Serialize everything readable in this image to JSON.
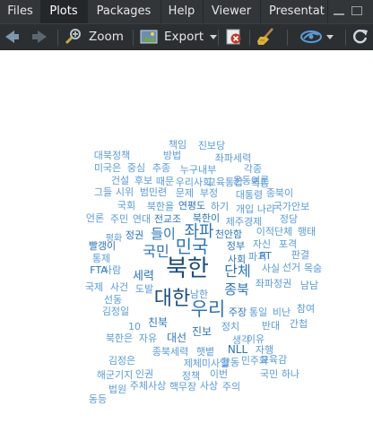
{
  "tabs": [
    {
      "label": "Files"
    },
    {
      "label": "Plots"
    },
    {
      "label": "Packages"
    },
    {
      "label": "Help"
    },
    {
      "label": "Viewer"
    },
    {
      "label": "Presentat"
    }
  ],
  "toolbar": {
    "zoom_label": "Zoom",
    "export_label": "Export"
  },
  "colors": {
    "dark_blue": "#1f4e79",
    "mid_blue": "#2e75b6",
    "light_blue": "#5b9bd5"
  },
  "wordcloud": [
    {
      "w": "북한",
      "c": "dark_blue"
    },
    {
      "w": "대한",
      "c": "dark_blue"
    },
    {
      "w": "우리",
      "c": "mid_blue"
    },
    {
      "w": "민국",
      "c": "mid_blue"
    },
    {
      "w": "좌파",
      "c": "mid_blue"
    },
    {
      "w": "국민",
      "c": "mid_blue"
    },
    {
      "w": "단체",
      "c": "mid_blue"
    },
    {
      "w": "종북",
      "c": "mid_blue"
    },
    {
      "w": "들이",
      "c": "mid_blue"
    },
    {
      "w": "세력",
      "c": "mid_blue"
    },
    {
      "w": "책임",
      "c": "light_blue"
    },
    {
      "w": "진보당",
      "c": "light_blue"
    },
    {
      "w": "대북정책",
      "c": "light_blue"
    },
    {
      "w": "방법",
      "c": "light_blue"
    },
    {
      "w": "좌파세력",
      "c": "light_blue"
    },
    {
      "w": "각종",
      "c": "light_blue"
    },
    {
      "w": "미국은",
      "c": "light_blue"
    },
    {
      "w": "중심",
      "c": "light_blue"
    },
    {
      "w": "추종",
      "c": "light_blue"
    },
    {
      "w": "누구내부",
      "c": "light_blue"
    },
    {
      "w": "운동여론",
      "c": "light_blue"
    },
    {
      "w": "건설",
      "c": "light_blue"
    },
    {
      "w": "후보",
      "c": "light_blue"
    },
    {
      "w": "때문",
      "c": "light_blue"
    },
    {
      "w": "우리사회",
      "c": "light_blue"
    },
    {
      "w": "교육통합",
      "c": "light_blue"
    },
    {
      "w": "폭동",
      "c": "light_blue"
    },
    {
      "w": "그들",
      "c": "light_blue"
    },
    {
      "w": "시위",
      "c": "light_blue"
    },
    {
      "w": "범민련",
      "c": "light_blue"
    },
    {
      "w": "문제",
      "c": "light_blue"
    },
    {
      "w": "부정",
      "c": "light_blue"
    },
    {
      "w": "대통령",
      "c": "light_blue"
    },
    {
      "w": "종북이",
      "c": "light_blue"
    },
    {
      "w": "국회",
      "c": "light_blue"
    },
    {
      "w": "북한을",
      "c": "light_blue"
    },
    {
      "w": "연평도",
      "c": "mid_blue"
    },
    {
      "w": "하기",
      "c": "light_blue"
    },
    {
      "w": "개입",
      "c": "light_blue"
    },
    {
      "w": "나라",
      "c": "light_blue"
    },
    {
      "w": "국가안보",
      "c": "light_blue"
    },
    {
      "w": "언론",
      "c": "light_blue"
    },
    {
      "w": "주민",
      "c": "light_blue"
    },
    {
      "w": "연대",
      "c": "light_blue"
    },
    {
      "w": "전교조",
      "c": "mid_blue"
    },
    {
      "w": "북한이",
      "c": "mid_blue"
    },
    {
      "w": "제주경제",
      "c": "light_blue"
    },
    {
      "w": "정당",
      "c": "light_blue"
    },
    {
      "w": "평화",
      "c": "light_blue"
    },
    {
      "w": "정권",
      "c": "mid_blue"
    },
    {
      "w": "천안함",
      "c": "mid_blue"
    },
    {
      "w": "이적단체",
      "c": "light_blue"
    },
    {
      "w": "행태",
      "c": "light_blue"
    },
    {
      "w": "정부",
      "c": "mid_blue"
    },
    {
      "w": "자신",
      "c": "light_blue"
    },
    {
      "w": "포격",
      "c": "light_blue"
    },
    {
      "w": "RT",
      "c": "mid_blue"
    },
    {
      "w": "파괴",
      "c": "light_blue"
    },
    {
      "w": "판결",
      "c": "light_blue"
    },
    {
      "w": "사회",
      "c": "mid_blue"
    },
    {
      "w": "사실",
      "c": "light_blue"
    },
    {
      "w": "선거",
      "c": "light_blue"
    },
    {
      "w": "목숨",
      "c": "light_blue"
    },
    {
      "w": "빨갱이",
      "c": "mid_blue"
    },
    {
      "w": "국제",
      "c": "light_blue"
    },
    {
      "w": "사건",
      "c": "light_blue"
    },
    {
      "w": "도발",
      "c": "light_blue"
    },
    {
      "w": "좌파정권",
      "c": "light_blue"
    },
    {
      "w": "남남",
      "c": "light_blue"
    },
    {
      "w": "남한",
      "c": "light_blue"
    },
    {
      "w": "김정일",
      "c": "light_blue"
    },
    {
      "w": "선동",
      "c": "light_blue"
    },
    {
      "w": "주장",
      "c": "mid_blue"
    },
    {
      "w": "통일",
      "c": "light_blue"
    },
    {
      "w": "비난",
      "c": "light_blue"
    },
    {
      "w": "참여",
      "c": "light_blue"
    },
    {
      "w": "친북",
      "c": "mid_blue"
    },
    {
      "w": "진보",
      "c": "mid_blue"
    },
    {
      "w": "대선",
      "c": "mid_blue"
    },
    {
      "w": "정치",
      "c": "light_blue"
    },
    {
      "w": "생각",
      "c": "light_blue"
    },
    {
      "w": "반대",
      "c": "light_blue"
    },
    {
      "w": "간첩",
      "c": "light_blue"
    },
    {
      "w": "북한은",
      "c": "light_blue"
    },
    {
      "w": "자유",
      "c": "light_blue"
    },
    {
      "w": "10",
      "c": "light_blue"
    },
    {
      "w": "NLL",
      "c": "mid_blue"
    },
    {
      "w": "햇볕",
      "c": "light_blue"
    },
    {
      "w": "활동",
      "c": "light_blue"
    },
    {
      "w": "이유",
      "c": "light_blue"
    },
    {
      "w": "자행",
      "c": "light_blue"
    },
    {
      "w": "종북세력",
      "c": "light_blue"
    },
    {
      "w": "민주화",
      "c": "light_blue"
    },
    {
      "w": "김정은",
      "c": "light_blue"
    },
    {
      "w": "제체미사일",
      "c": "light_blue"
    },
    {
      "w": "교육감",
      "c": "light_blue"
    },
    {
      "w": "인권",
      "c": "light_blue"
    },
    {
      "w": "해군기지",
      "c": "light_blue"
    },
    {
      "w": "정책",
      "c": "light_blue"
    },
    {
      "w": "이번",
      "c": "light_blue"
    },
    {
      "w": "주체사상",
      "c": "light_blue"
    },
    {
      "w": "핵무장",
      "c": "light_blue"
    },
    {
      "w": "사상",
      "c": "light_blue"
    },
    {
      "w": "주의",
      "c": "light_blue"
    },
    {
      "w": "법원",
      "c": "light_blue"
    },
    {
      "w": "FTA",
      "c": "mid_blue"
    },
    {
      "w": "동등",
      "c": "light_blue"
    },
    {
      "w": "국민 하나",
      "c": "light_blue"
    },
    {
      "w": "통제",
      "c": "light_blue"
    },
    {
      "w": "사람",
      "c": "light_blue"
    }
  ]
}
